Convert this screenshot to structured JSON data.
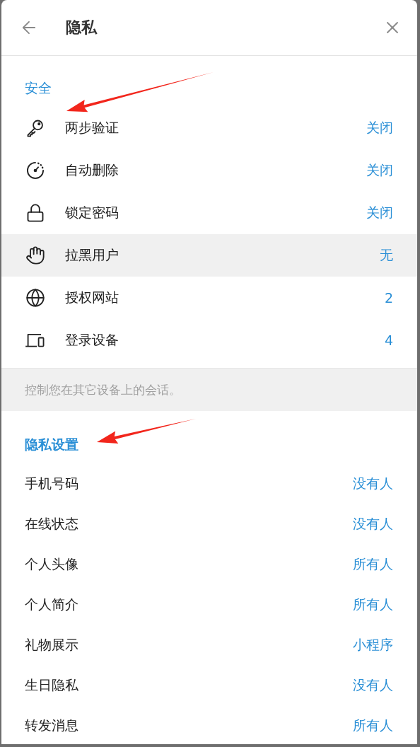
{
  "header": {
    "title": "隐私"
  },
  "sections": [
    {
      "title": "安全",
      "title_bold": false,
      "marked": true,
      "rows": [
        {
          "label": "两步验证",
          "value": "关闭",
          "highlighted": false
        },
        {
          "label": "自动删除",
          "value": "关闭",
          "highlighted": false
        },
        {
          "label": "锁定密码",
          "value": "关闭",
          "highlighted": false
        },
        {
          "label": "拉黑用户",
          "value": "无",
          "highlighted": true
        },
        {
          "label": "授权网站",
          "value": "2",
          "highlighted": false
        },
        {
          "label": "登录设备",
          "value": "4",
          "highlighted": false
        }
      ],
      "note": "控制您在其它设备上的会话。"
    },
    {
      "title": "隐私设置",
      "title_bold": true,
      "marked": true,
      "rows": [
        {
          "label": "手机号码",
          "value": "没有人",
          "highlighted": false
        },
        {
          "label": "在线状态",
          "value": "没有人",
          "highlighted": false
        },
        {
          "label": "个人头像",
          "value": "所有人",
          "highlighted": false
        },
        {
          "label": "个人简介",
          "value": "所有人",
          "highlighted": false
        },
        {
          "label": "礼物展示",
          "value": "小程序",
          "highlighted": false
        },
        {
          "label": "生日隐私",
          "value": "没有人",
          "highlighted": false
        },
        {
          "label": "转发消息",
          "value": "所有人",
          "highlighted": false
        }
      ]
    }
  ]
}
